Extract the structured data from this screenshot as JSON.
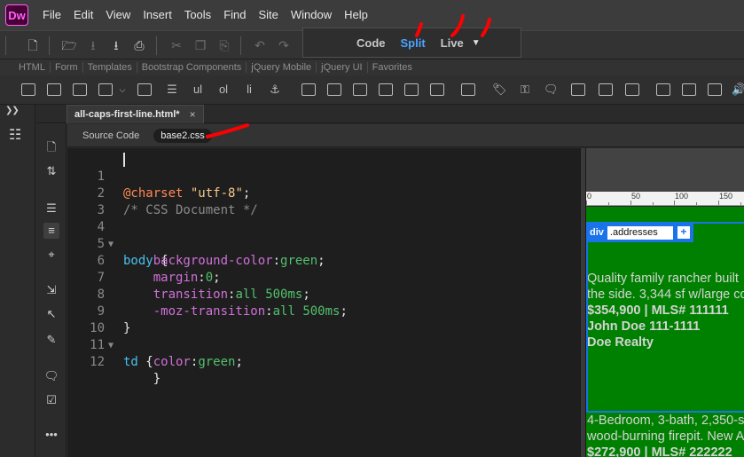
{
  "app": {
    "logo": "Dw"
  },
  "menu": [
    "File",
    "Edit",
    "View",
    "Insert",
    "Tools",
    "Find",
    "Site",
    "Window",
    "Help"
  ],
  "view_switch": {
    "code": "Code",
    "split": "Split",
    "live": "Live"
  },
  "insert_tabs": [
    "HTML",
    "Form",
    "Templates",
    "Bootstrap Components",
    "jQuery Mobile",
    "jQuery UI",
    "Favorites"
  ],
  "document": {
    "tab_title": "all-caps-first-line.html*",
    "close_glyph": "×"
  },
  "related_files": {
    "source": "Source Code",
    "css": "base2.css"
  },
  "code": {
    "lines": [
      {
        "n": "1",
        "charset_kw": "@charset",
        "charset_val": "\"utf-8\"",
        "end": ";"
      },
      {
        "n": "2",
        "comment": "/* CSS Document */"
      },
      {
        "n": "3"
      },
      {
        "n": "4",
        "selector": "body",
        "brace": " {"
      },
      {
        "n": "5",
        "prop": "background-color",
        "val": "green"
      },
      {
        "n": "6",
        "prop": "margin",
        "val": "0"
      },
      {
        "n": "7",
        "prop": "transition",
        "val": "all",
        "val2": "500ms"
      },
      {
        "n": "8",
        "prop": "-moz-transition",
        "val": "all",
        "val2": "500ms"
      },
      {
        "n": "9",
        "brace": "}"
      },
      {
        "n": "10",
        "selector": "td",
        "brace": " {"
      },
      {
        "n": "11",
        "prop": "color",
        "val": "green"
      },
      {
        "n": "12",
        "brace": "}"
      }
    ]
  },
  "live_view": {
    "ruler": [
      "0",
      "50",
      "100",
      "150"
    ],
    "hud": {
      "tag": "div",
      "class_value": ".addresses",
      "add": "+"
    },
    "listing1": {
      "line1": "Quality family rancher built",
      "line2": "the side. 3,344 sf w/large co",
      "price": "$354,900 | MLS# 111111",
      "agent": "John Doe 111-1111",
      "company": "Doe Realty"
    },
    "listing2": {
      "line1": "4-Bedroom, 3-bath, 2,350-s",
      "line2": "wood-burning firepit. New A",
      "price": "$272,900 | MLS# 222222"
    }
  },
  "colors": {
    "accent": "#4aa3ff",
    "annotation": "#ff0000",
    "live_bg": "#008000",
    "hud": "#1a73e8"
  }
}
